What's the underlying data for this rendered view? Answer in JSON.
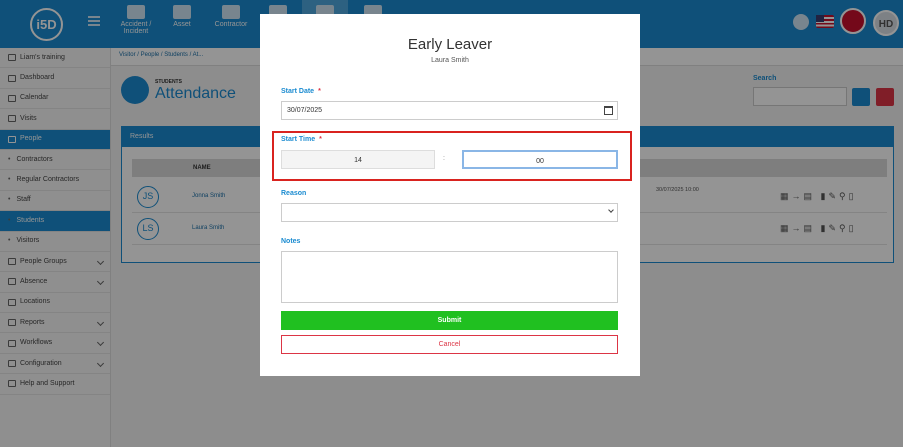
{
  "app": {
    "logo_text": "i5D"
  },
  "topnav": {
    "items": [
      {
        "label": "Accident / Incident",
        "icon": "first-aid-icon"
      },
      {
        "label": "Asset",
        "icon": "boxes-icon"
      },
      {
        "label": "Contractor",
        "icon": "hardhat-icon"
      }
    ],
    "avatar_initials": "HD"
  },
  "sidebar": {
    "items": [
      {
        "label": "Liam's training",
        "type": "main"
      },
      {
        "label": "Dashboard",
        "type": "main"
      },
      {
        "label": "Calendar",
        "type": "main"
      },
      {
        "label": "Visits",
        "type": "main"
      },
      {
        "label": "People",
        "type": "main",
        "active": true
      },
      {
        "label": "Contractors",
        "type": "sub"
      },
      {
        "label": "Regular Contractors",
        "type": "sub"
      },
      {
        "label": "Staff",
        "type": "sub"
      },
      {
        "label": "Students",
        "type": "sub",
        "active": true
      },
      {
        "label": "Visitors",
        "type": "sub"
      },
      {
        "label": "People Groups",
        "type": "main",
        "expandable": true
      },
      {
        "label": "Absence",
        "type": "main",
        "expandable": true
      },
      {
        "label": "Locations",
        "type": "main"
      },
      {
        "label": "Reports",
        "type": "main",
        "expandable": true
      },
      {
        "label": "Workflows",
        "type": "main",
        "expandable": true
      },
      {
        "label": "Configuration",
        "type": "main",
        "expandable": true
      },
      {
        "label": "Help and Support",
        "type": "main"
      }
    ]
  },
  "breadcrumb": {
    "text": "Visitor  /  People  /  Students  /  At..."
  },
  "page": {
    "kicker": "STUDENTS",
    "title": "Attendance"
  },
  "search": {
    "label": "Search"
  },
  "results": {
    "title": "Results",
    "column_name": "NAME",
    "rows": [
      {
        "initials": "JS",
        "name": "Jonna Smith",
        "time": "30/07/2025 10:00"
      },
      {
        "initials": "LS",
        "name": "Laura Smith",
        "time": ""
      }
    ]
  },
  "modal": {
    "title": "Early Leaver",
    "subtitle": "Laura Smith",
    "start_date_label": "Start Date",
    "start_date_value": "30/07/2025",
    "start_time_label": "Start Time",
    "hour_value": "14",
    "time_separator": ":",
    "minute_value": "00",
    "reason_label": "Reason",
    "reason_value": "",
    "notes_label": "Notes",
    "submit_label": "Submit",
    "cancel_label": "Cancel",
    "required_mark": "*"
  },
  "colors": {
    "primary": "#1a8bd0",
    "submit": "#20c020",
    "danger": "#dc3545",
    "highlight": "#d9231f"
  }
}
